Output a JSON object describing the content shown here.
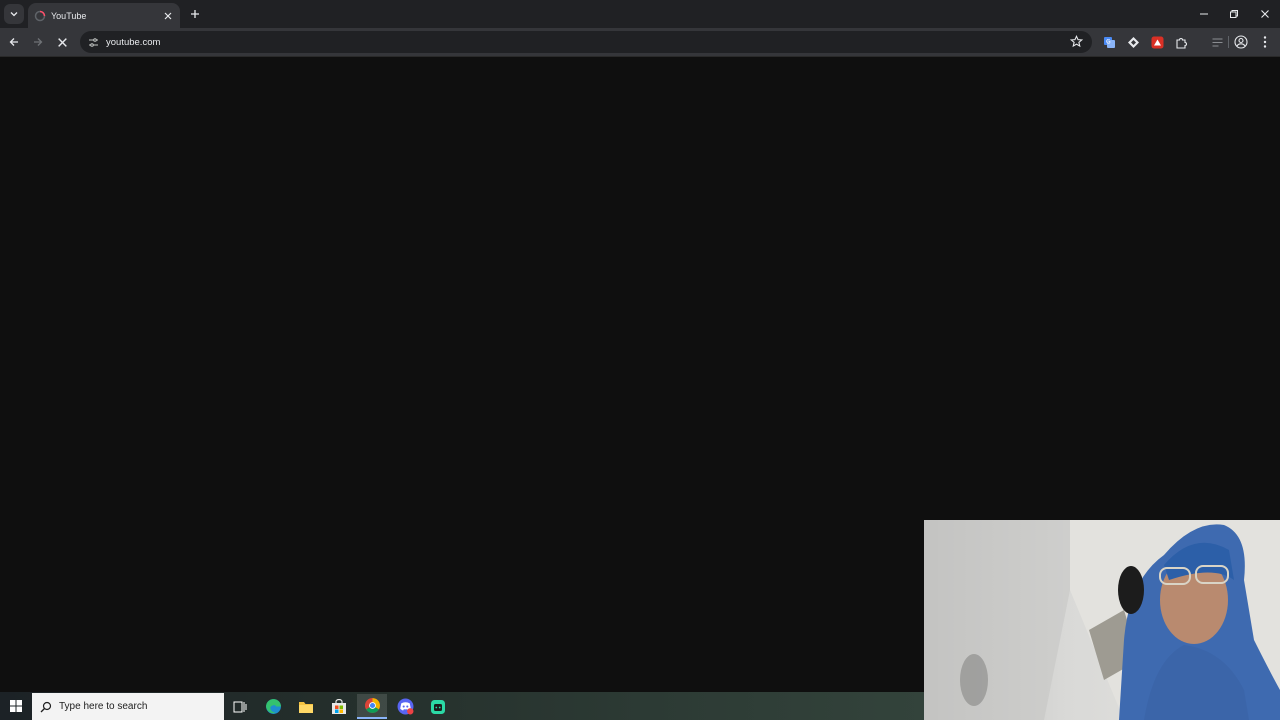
{
  "browser": {
    "tab": {
      "title": "YouTube",
      "favicon": "loading-favicon-icon"
    },
    "toolbar": {
      "url": "youtube.com"
    },
    "extensions": [
      "translate-extension-icon",
      "diamond-extension-icon",
      "red-extension-icon",
      "puzzle-extensions-icon"
    ]
  },
  "taskbar": {
    "search_placeholder": "Type here to search",
    "apps": [
      "task-view-icon",
      "edge-icon",
      "file-explorer-icon",
      "store-icon",
      "chrome-icon",
      "discord-icon",
      "app-icon"
    ]
  },
  "colors": {
    "page_bg": "#0f0f0f",
    "chrome_dark": "#202124",
    "chrome_toolbar": "#35363a",
    "accent": "#8ab4f8"
  }
}
